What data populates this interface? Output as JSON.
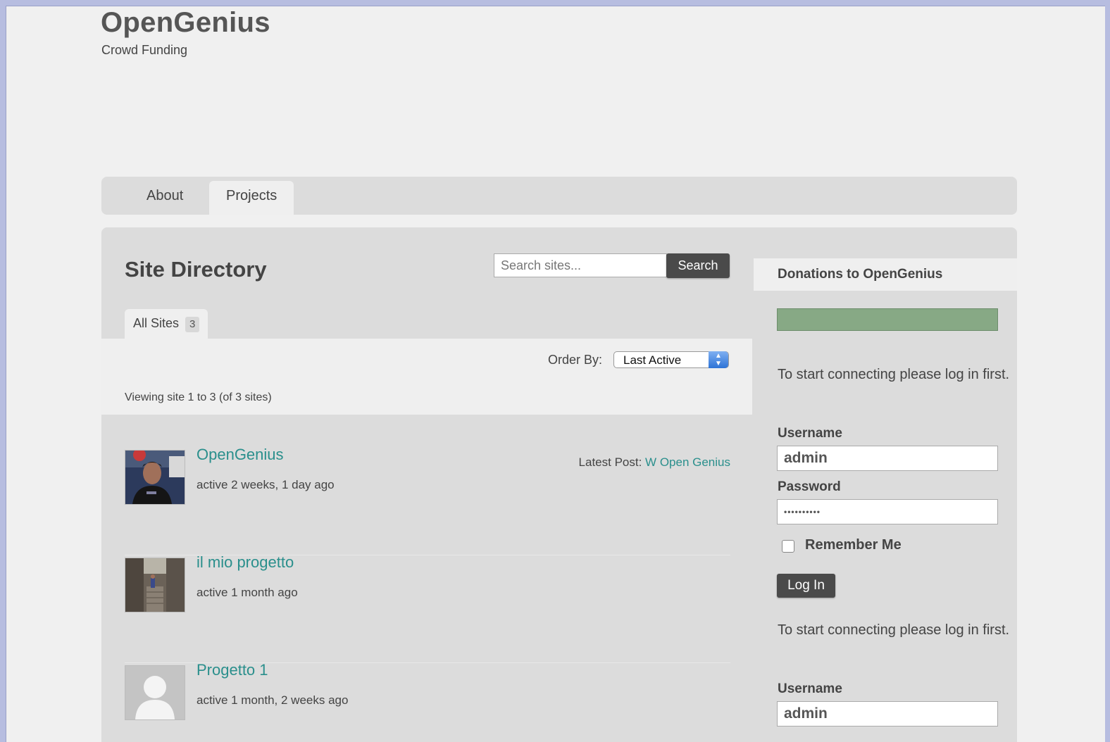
{
  "site": {
    "title": "OpenGenius",
    "tagline": "Crowd Funding"
  },
  "nav": {
    "items": [
      {
        "label": "About"
      },
      {
        "label": "Projects"
      }
    ]
  },
  "directory": {
    "title": "Site Directory",
    "search_placeholder": "Search sites...",
    "search_button": "Search",
    "tab_label": "All Sites",
    "tab_count": "3",
    "order_label": "Order By:",
    "order_value": "Last Active",
    "viewing_text": "Viewing site 1 to 3 (of 3 sites)",
    "sites": [
      {
        "name": "OpenGenius",
        "active": "active 2 weeks, 1 day ago",
        "latest_label": "Latest Post:",
        "latest_link": "W Open Genius"
      },
      {
        "name": "il mio progetto",
        "active": "active 1 month ago"
      },
      {
        "name": "Progetto 1",
        "active": "active 1 month, 2 weeks ago"
      }
    ]
  },
  "sidebar": {
    "donations_title": "Donations to OpenGenius",
    "connect_text": "To start connecting please log in first.",
    "username_label": "Username",
    "username_value": "admin",
    "password_label": "Password",
    "password_value": "••••••••••",
    "remember_label": "Remember Me",
    "login_button": "Log In"
  },
  "colors": {
    "link": "#2a8f8c",
    "donation_bar": "#87a985",
    "button": "#4a4a4a"
  }
}
